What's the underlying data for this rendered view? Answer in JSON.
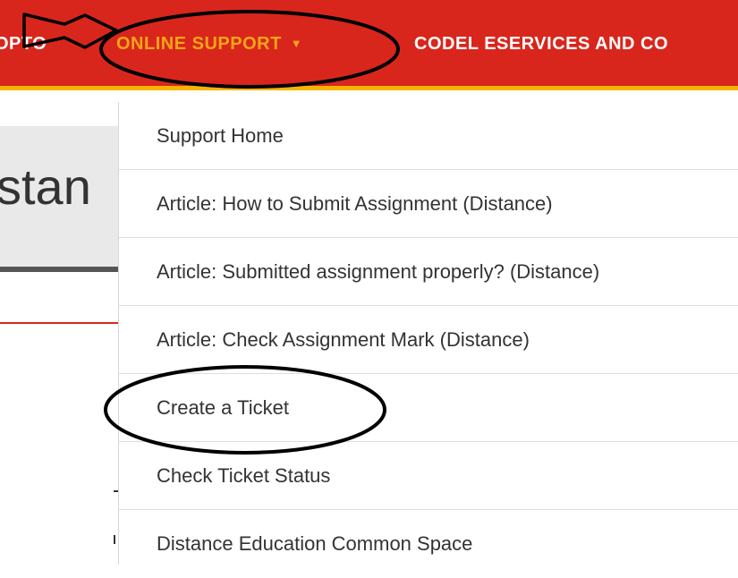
{
  "navbar": {
    "left_item": "OPTO",
    "active_item": "ONLINE SUPPORT",
    "caret": "▼",
    "right_item": "CODEL ESERVICES AND CO"
  },
  "page": {
    "title_fragment": "stan"
  },
  "dropdown": {
    "items": [
      {
        "label": "Support Home"
      },
      {
        "label": "Article: How to Submit Assignment (Distance)"
      },
      {
        "label": "Article: Submitted assignment properly? (Distance)"
      },
      {
        "label": "Article: Check Assignment Mark (Distance)"
      },
      {
        "label": "Create a Ticket"
      },
      {
        "label": "Check Ticket Status"
      },
      {
        "label": "Distance Education Common Space"
      }
    ]
  },
  "colors": {
    "navbar_bg": "#d9261c",
    "navbar_accent": "#f5b400",
    "active_text": "#f6a51a",
    "annotation": "#000000"
  },
  "annotations": [
    "arrow-pointing-right",
    "ellipse-around-online-support",
    "ellipse-around-create-a-ticket"
  ]
}
